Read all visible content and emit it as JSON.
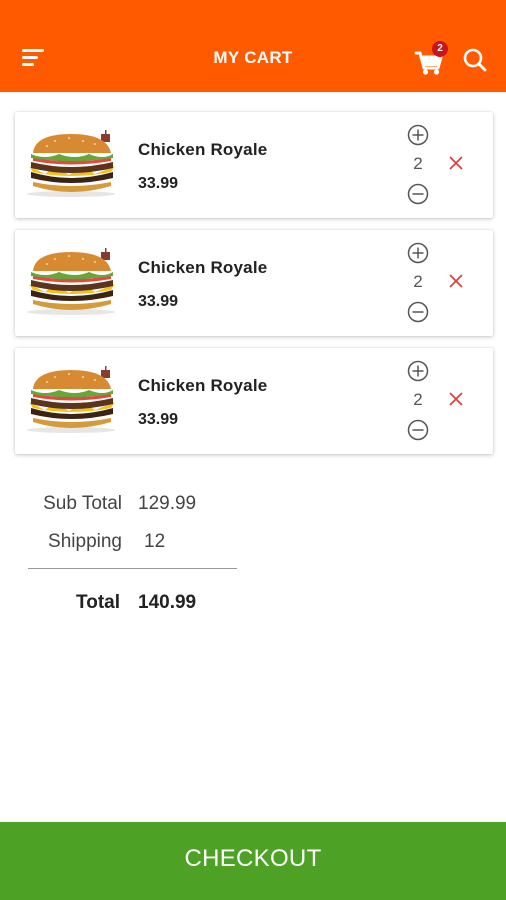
{
  "header": {
    "title": "MY CART",
    "cart_count": "2",
    "icons": {
      "menu": "menu-icon",
      "cart": "cart-icon",
      "search": "search-icon"
    }
  },
  "items": [
    {
      "name": "Chicken Royale",
      "price": "33.99",
      "quantity": "2"
    },
    {
      "name": "Chicken Royale",
      "price": "33.99",
      "quantity": "2"
    },
    {
      "name": "Chicken Royale",
      "price": "33.99",
      "quantity": "2"
    }
  ],
  "summary": {
    "subtotal_label": "Sub Total",
    "subtotal_value": "129.99",
    "shipping_label": "Shipping",
    "shipping_value": "12",
    "total_label": "Total",
    "total_value": "140.99"
  },
  "checkout_label": "CHECKOUT",
  "colors": {
    "header": "#ff5a00",
    "checkout": "#4da125",
    "badge": "#c8151b",
    "remove": "#e53935"
  }
}
